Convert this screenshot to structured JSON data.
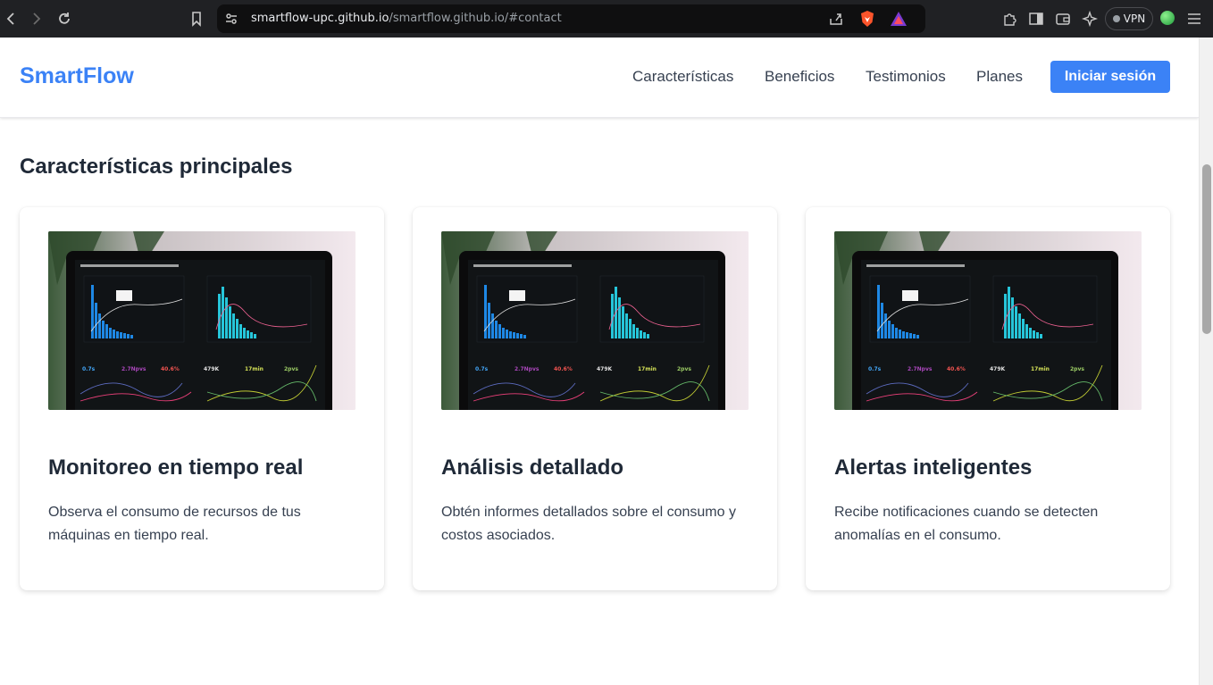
{
  "browser": {
    "url_host": "smartflow-upc.github.io",
    "url_path": "/smartflow.github.io/#contact",
    "vpn_label": "VPN"
  },
  "header": {
    "brand": "SmartFlow",
    "nav": [
      "Características",
      "Beneficios",
      "Testimonios",
      "Planes"
    ],
    "login_label": "Iniciar sesión"
  },
  "features": {
    "title": "Características principales",
    "cards": [
      {
        "title": "Monitoreo en tiempo real",
        "text": "Observa el consumo de recursos de tus máquinas en tiempo real."
      },
      {
        "title": "Análisis detallado",
        "text": "Obtén informes detallados sobre el consumo y costos asociados."
      },
      {
        "title": "Alertas inteligentes",
        "text": "Recibe notificaciones cuando se detecten anomalías en el consumo."
      }
    ]
  },
  "colors": {
    "brand": "#3b82f6",
    "heading": "#1f2937",
    "body_text": "#374151",
    "chrome_bg": "#202124"
  }
}
